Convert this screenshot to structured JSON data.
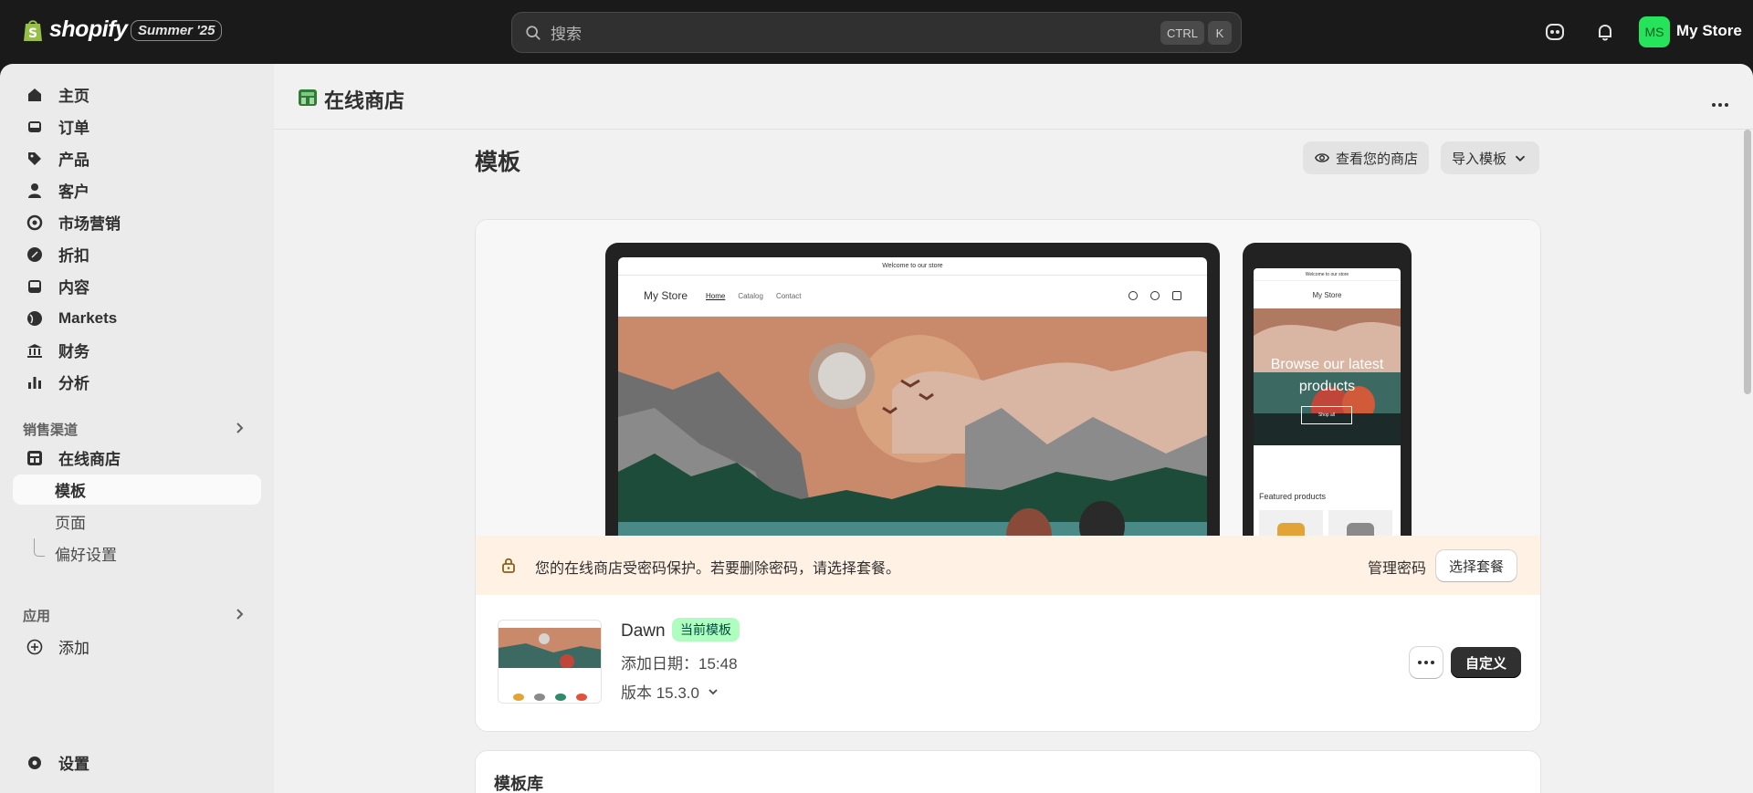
{
  "topbar": {
    "logo_text": "shopify",
    "edition_badge": "Summer '25",
    "search_placeholder": "搜索",
    "shortcut_ctrl": "CTRL",
    "shortcut_k": "K",
    "avatar_initials": "MS",
    "store_name": "My Store"
  },
  "sidebar": {
    "items": [
      {
        "label": "主页",
        "icon": "home-icon"
      },
      {
        "label": "订单",
        "icon": "inbox-icon"
      },
      {
        "label": "产品",
        "icon": "tag-icon"
      },
      {
        "label": "客户",
        "icon": "person-icon"
      },
      {
        "label": "市场营销",
        "icon": "target-icon"
      },
      {
        "label": "折扣",
        "icon": "discount-icon"
      },
      {
        "label": "内容",
        "icon": "image-icon"
      },
      {
        "label": "Markets",
        "icon": "globe-icon"
      },
      {
        "label": "财务",
        "icon": "bank-icon"
      },
      {
        "label": "分析",
        "icon": "chart-icon"
      }
    ],
    "sales_channels_title": "销售渠道",
    "online_store": "在线商店",
    "themes": "模板",
    "pages": "页面",
    "preferences": "偏好设置",
    "apps_title": "应用",
    "add": "添加",
    "settings": "设置"
  },
  "header": {
    "title": "在线商店"
  },
  "page": {
    "title": "模板",
    "view_store": "查看您的商店",
    "import_theme": "导入模板"
  },
  "preview": {
    "announcement": "Welcome to our store",
    "store_name": "My Store",
    "nav_home": "Home",
    "nav_catalog": "Catalog",
    "nav_contact": "Contact",
    "hero_text": "Browse our latest products",
    "shop_all": "Shop all",
    "featured": "Featured products"
  },
  "banner": {
    "text": "您的在线商店受密码保护。若要删除密码，请选择套餐。",
    "manage_password": "管理密码",
    "choose_plan": "选择套餐"
  },
  "current_theme": {
    "name": "Dawn",
    "badge": "当前模板",
    "added": "添加日期：15:48",
    "version": "版本 15.3.0",
    "customize": "自定义"
  },
  "library": {
    "title": "模板库"
  },
  "colors": {
    "brand_green": "#25e35a",
    "badge_green": "#affebf",
    "banner_bg": "#fff1e3"
  }
}
